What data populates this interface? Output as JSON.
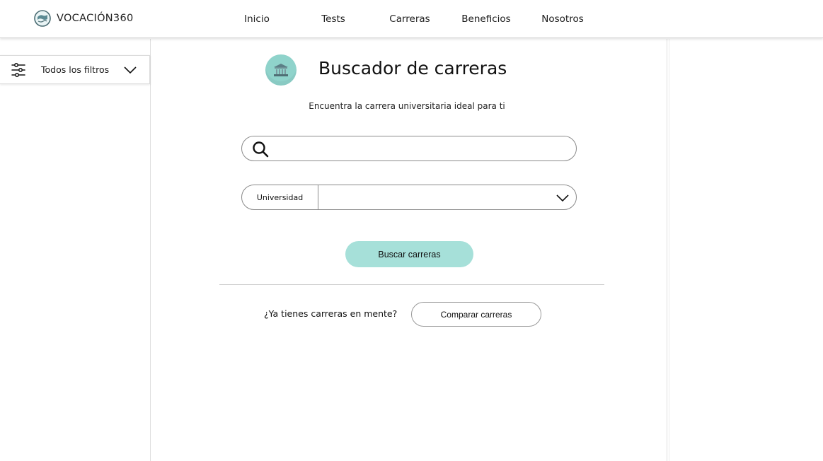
{
  "header": {
    "logo_text": "VOCACIÓN360",
    "nav": [
      {
        "label": "Inicio"
      },
      {
        "label": "Tests"
      },
      {
        "label": "Carreras"
      },
      {
        "label": "Beneficios"
      },
      {
        "label": "Nosotros"
      }
    ]
  },
  "sidebar": {
    "filter_label": "Todos los filtros",
    "filter_icon": "sliders-icon",
    "expand_icon": "chevron-down-icon"
  },
  "main": {
    "title": "Buscador de carreras",
    "title_icon": "university-icon",
    "subtitle": "Encuentra la carrera universitaria ideal para ti",
    "search": {
      "value": "",
      "placeholder": "",
      "icon": "search-icon"
    },
    "university_select": {
      "label": "Universidad",
      "value": "",
      "icon": "chevron-down-icon"
    },
    "search_button": "Buscar carreras",
    "compare_question": "¿Ya tienes carreras en mente?",
    "compare_button": "Comparar carreras"
  },
  "colors": {
    "accent": "#a6e0d9",
    "icon_circle": "#8fd3cb",
    "border": "#8a8a8a"
  }
}
